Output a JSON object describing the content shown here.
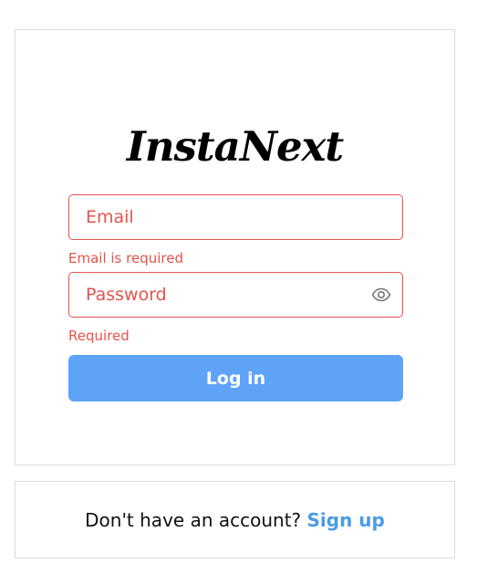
{
  "logo": {
    "text": "InstaNext"
  },
  "form": {
    "email": {
      "placeholder": "Email",
      "value": "",
      "error": "Email is required"
    },
    "password": {
      "placeholder": "Password",
      "value": "",
      "error": "Required",
      "toggle_icon": "eye-icon"
    },
    "login_label": "Log in"
  },
  "signup": {
    "prompt": "Don't have an account?",
    "link": "Sign up"
  },
  "colors": {
    "error": "#e5534b",
    "button": "#5ea3f7",
    "link": "#4b9be6",
    "border": "#dcdcdc"
  }
}
